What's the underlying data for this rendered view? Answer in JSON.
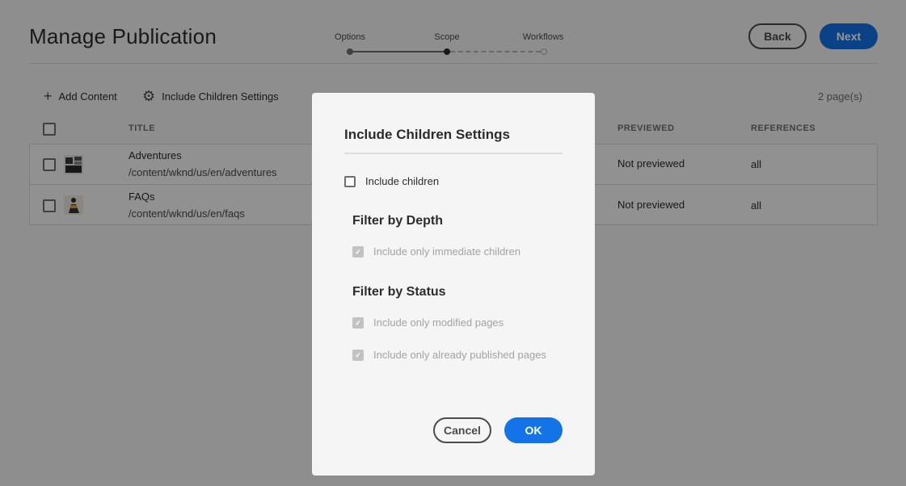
{
  "header": {
    "title": "Manage Publication",
    "back_label": "Back",
    "next_label": "Next"
  },
  "steps": [
    {
      "label": "Options",
      "state": "done"
    },
    {
      "label": "Scope",
      "state": "current"
    },
    {
      "label": "Workflows",
      "state": "future"
    }
  ],
  "toolbar": {
    "add_content_label": "Add Content",
    "add_content_icon": "plus-icon",
    "include_children_label": "Include Children Settings",
    "include_children_icon": "gear-icon",
    "page_count": "2 page(s)"
  },
  "table": {
    "columns": {
      "title": "TITLE",
      "previewed": "PREVIEWED",
      "references": "REFERENCES"
    },
    "rows": [
      {
        "title": "Adventures",
        "path": "/content/wknd/us/en/adventures",
        "previewed": "Not previewed",
        "references": "all"
      },
      {
        "title": "FAQs",
        "path": "/content/wknd/us/en/faqs",
        "previewed": "Not previewed",
        "references": "all"
      }
    ]
  },
  "dialog": {
    "title": "Include Children Settings",
    "include_children_label": "Include children",
    "include_children_checked": false,
    "depth_heading": "Filter by Depth",
    "immediate_children_label": "Include only immediate children",
    "status_heading": "Filter by Status",
    "modified_pages_label": "Include only modified pages",
    "published_pages_label": "Include only already published pages",
    "cancel_label": "Cancel",
    "ok_label": "OK"
  },
  "colors": {
    "accent": "#1473e6",
    "overlay": "rgba(0,0,0,0.42)"
  }
}
